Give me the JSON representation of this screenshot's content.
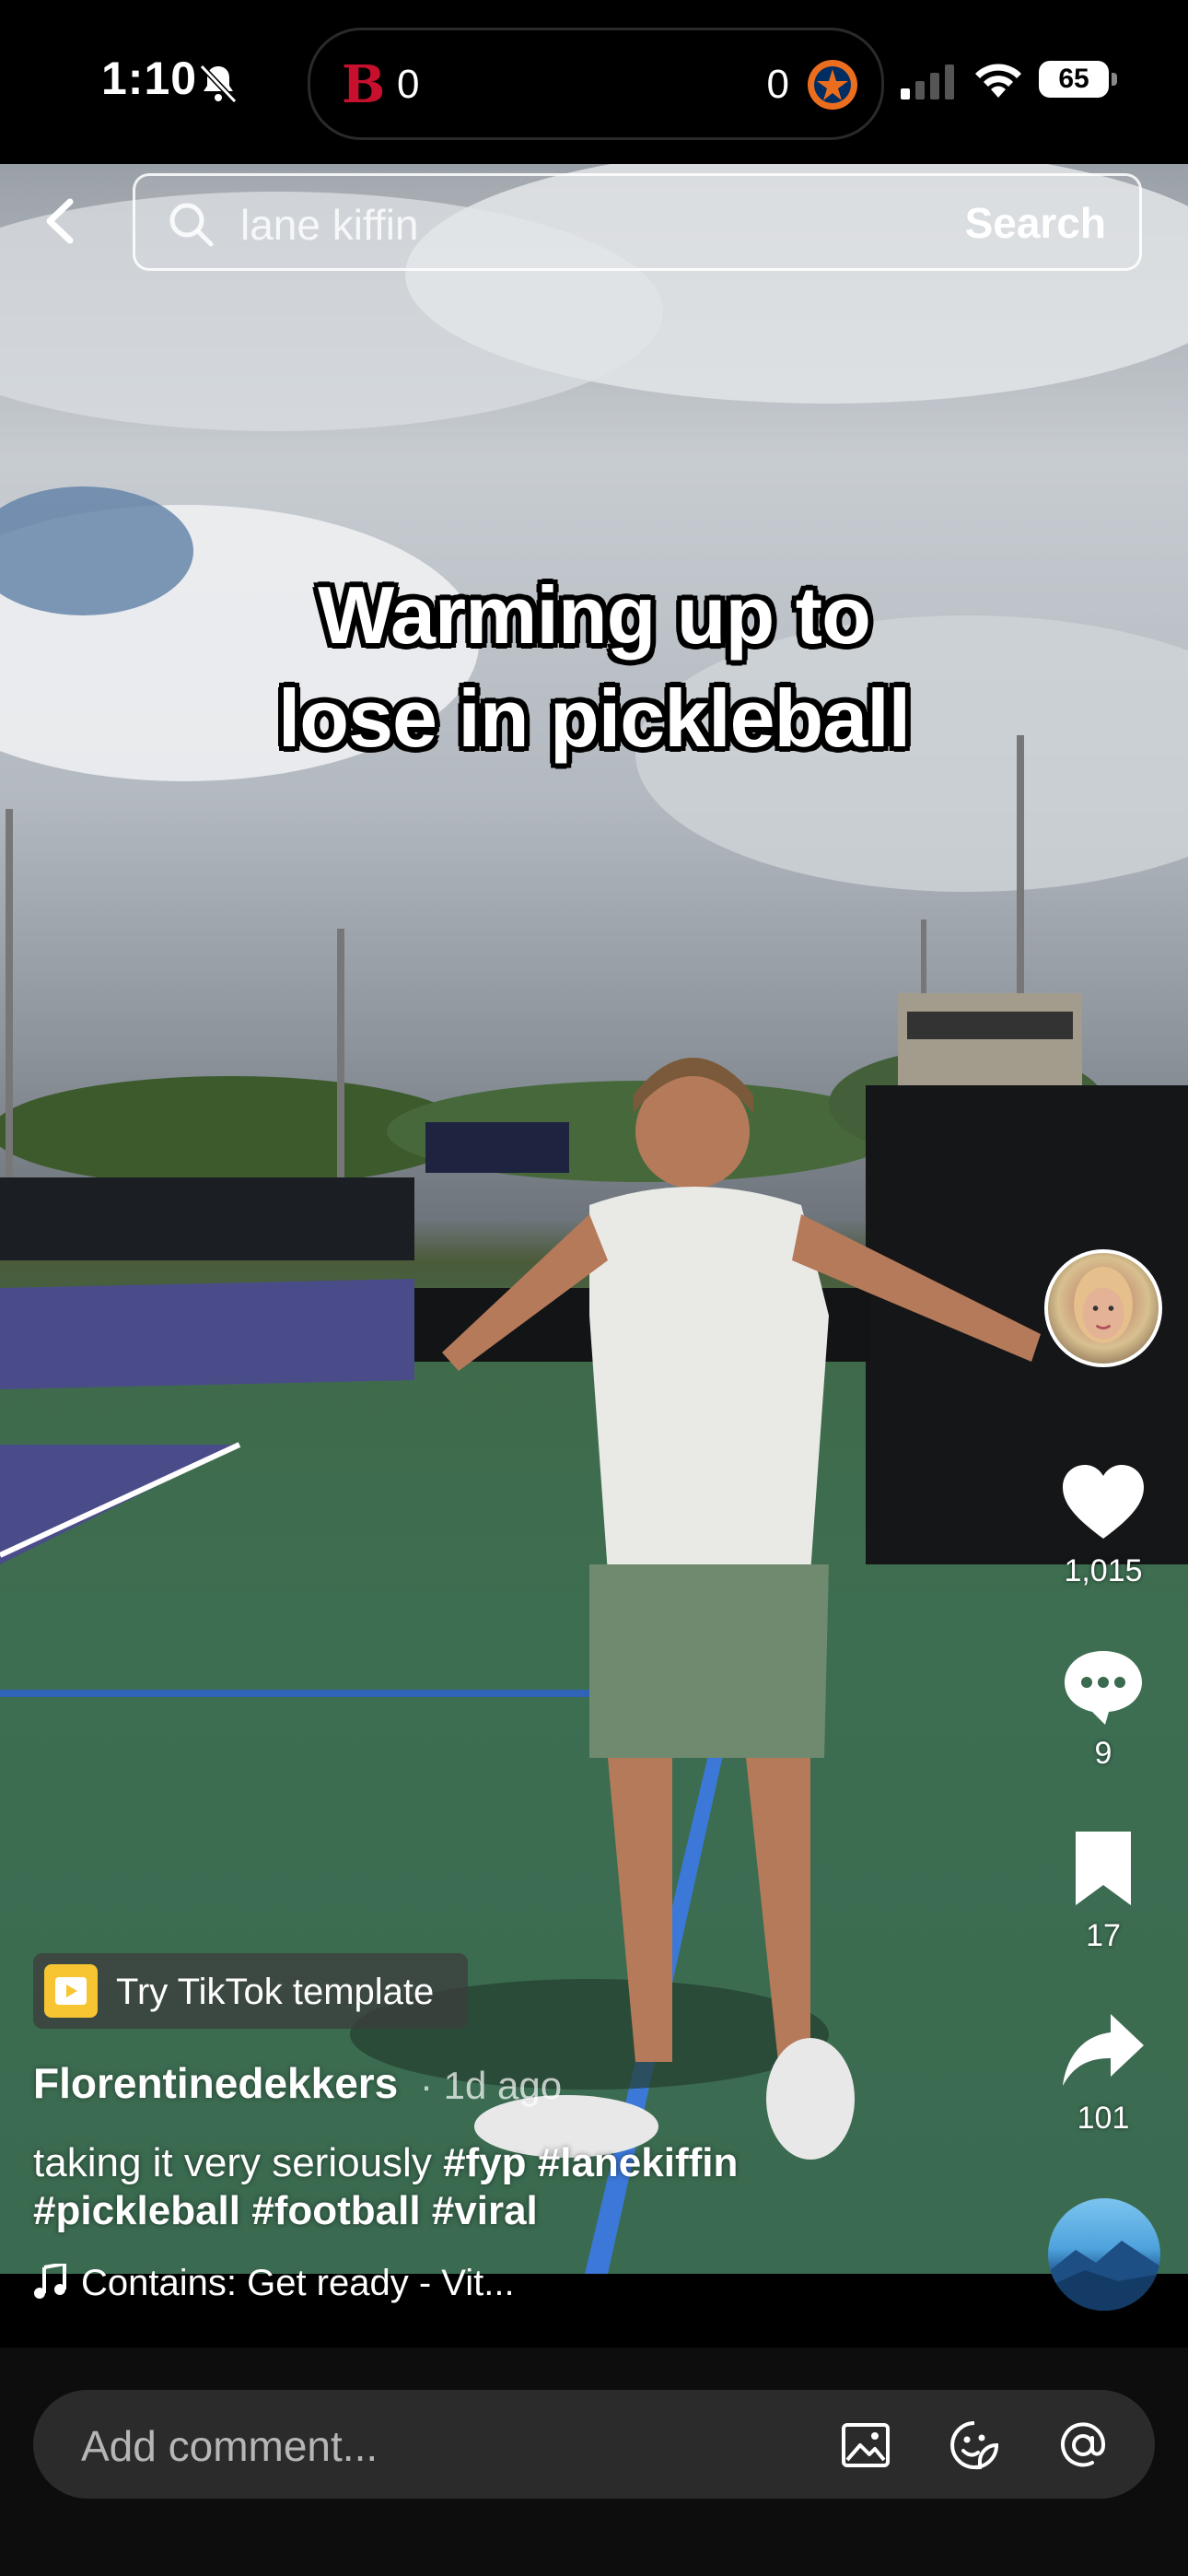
{
  "status_bar": {
    "time": "1:10",
    "score_left": "0",
    "score_right": "0",
    "battery": "65"
  },
  "search": {
    "query": "lane kiffin",
    "button_label": "Search"
  },
  "video": {
    "caption_line1": "Warming up to",
    "caption_line2": "lose in pickleball"
  },
  "actions": {
    "likes": "1,015",
    "comments": "9",
    "saves": "17",
    "shares": "101"
  },
  "post": {
    "template_label": "Try TikTok template",
    "username": "Florentinedekkers",
    "age": "· 1d ago",
    "description_text": "taking it very seriously ",
    "description_tags_line1": "#fyp #lanekiffin",
    "description_tags_line2": "#pickleball #football #viral",
    "sound": "Contains: Get ready - Vit..."
  },
  "comment_bar": {
    "placeholder": "Add comment..."
  },
  "colors": {
    "template_icon": "#f7c531",
    "comment_bg": "#2b2b2b",
    "like_icon": "#ffffff"
  }
}
